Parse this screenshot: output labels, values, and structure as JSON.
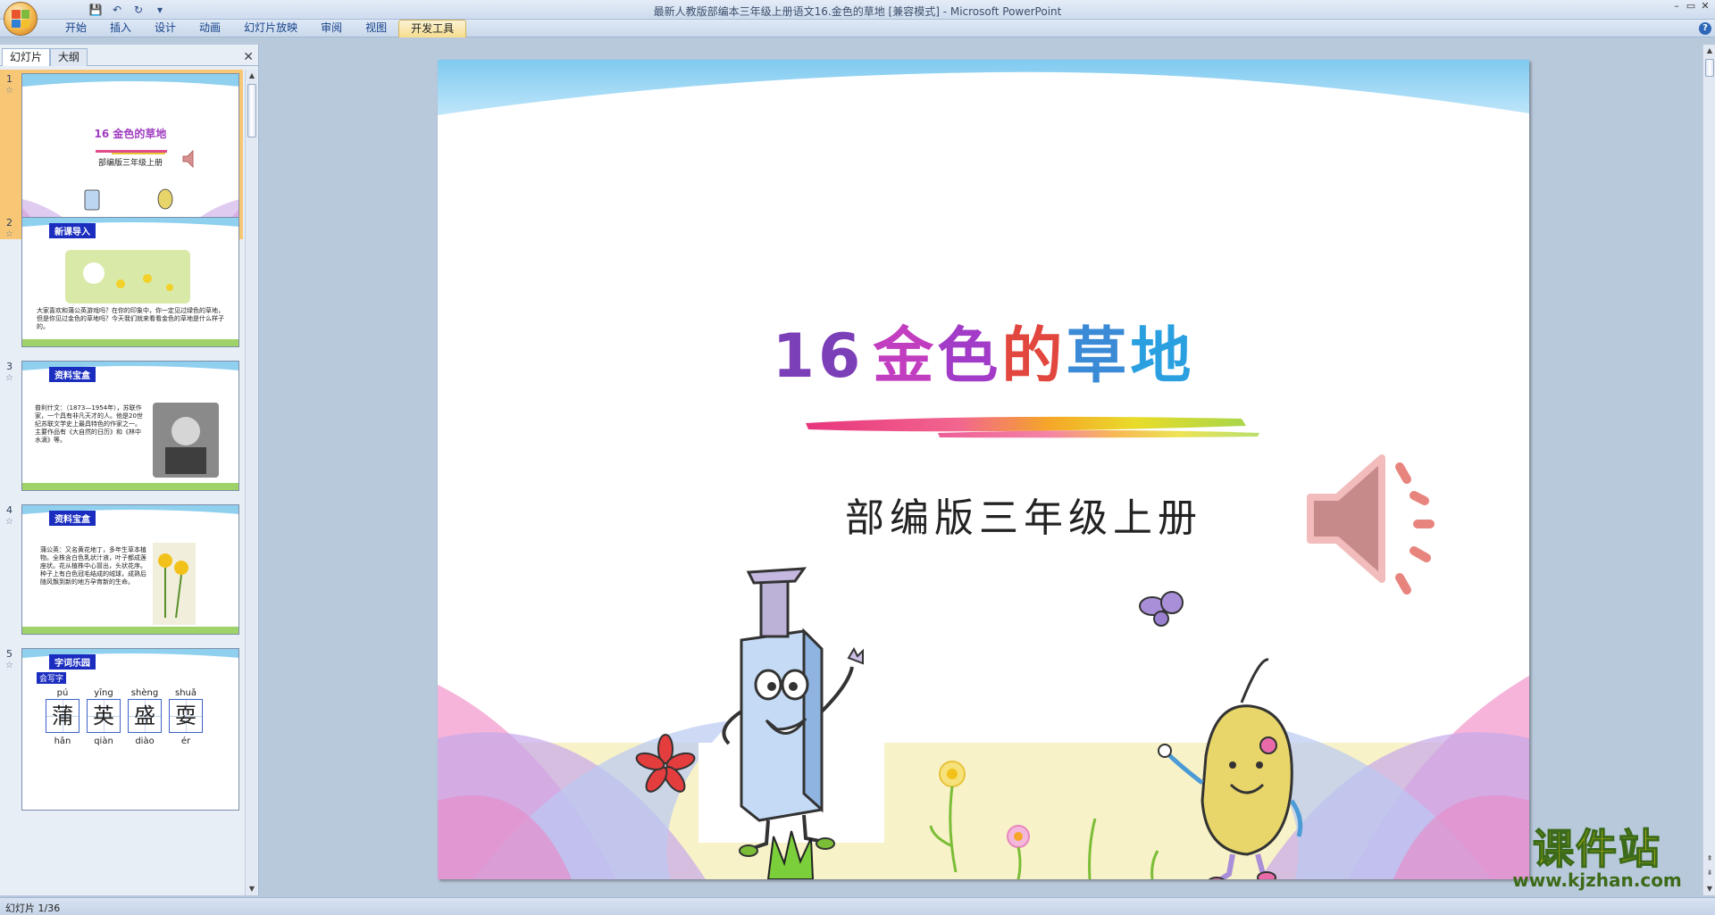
{
  "window": {
    "title": "最新人教版部编本三年级上册语文16.金色的草地 [兼容模式] - Microsoft PowerPoint",
    "controls": [
      "–",
      "▭",
      "✕"
    ]
  },
  "qat": {
    "save": "💾",
    "undo": "↶",
    "redo": "↻",
    "more": "▾"
  },
  "ribbon": {
    "tabs": [
      "开始",
      "插入",
      "设计",
      "动画",
      "幻灯片放映",
      "审阅",
      "视图",
      "开发工具"
    ],
    "active_tab": "开发工具",
    "help": "?"
  },
  "left_pane": {
    "tabs": [
      "幻灯片",
      "大纲"
    ],
    "close": "✕",
    "slides": [
      {
        "number": "1",
        "title": "16 金色的草地",
        "subtitle": "部编版三年级上册"
      },
      {
        "number": "2",
        "header": "新课导入",
        "text": "大家喜欢和蒲公英游戏吗？在你的印象中，你一定见过绿色的草地，但是你见过金色的草地吗？今天我们就来看看金色的草地是什么样子的。"
      },
      {
        "number": "3",
        "header": "资料宝盒",
        "text": "普利什文：（1873—1954年），苏联作家，一个具有非凡天才的人。他是20世纪苏联文学史上最具特色的作家之一。主要作品有《大自然的日历》和《林中水滴》等。"
      },
      {
        "number": "4",
        "header": "资料宝盒",
        "text": "蒲公英：又名黄花地丁，多年生草本植物。全株含白色乳状汁液，叶子都成莲座状。花从植株中心冒出，头状花序。种子上有白色冠毛结成的绒球，成熟后随风飘到新的地方孕育新的生命。"
      },
      {
        "number": "5",
        "header": "字词乐园",
        "badge": "会写字",
        "chars": [
          {
            "pinyin": "pú",
            "hanzi": "蒲"
          },
          {
            "pinyin": "yīng",
            "hanzi": "英"
          },
          {
            "pinyin": "shèng",
            "hanzi": "盛"
          },
          {
            "pinyin": "shuǎ",
            "hanzi": "耍"
          }
        ],
        "chars_row2": [
          "hǎn",
          "qiàn",
          "diào",
          "ér"
        ]
      }
    ]
  },
  "slide": {
    "number": "16",
    "title_chars": [
      "金",
      "色",
      "的",
      "草",
      "地"
    ],
    "subtitle": "部编版三年级上册"
  },
  "status": {
    "text": "幻灯片 1/36"
  },
  "watermark": {
    "main": "课件站",
    "url": "www.kjzhan.com"
  }
}
